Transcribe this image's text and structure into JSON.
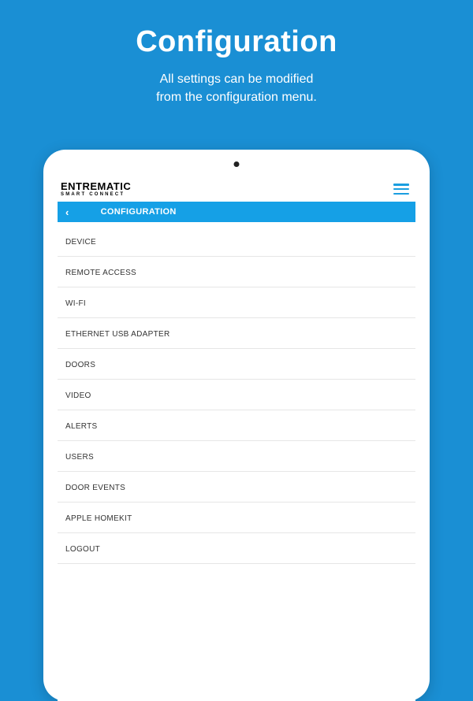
{
  "hero": {
    "title": "Configuration",
    "subtitle_line1": "All settings can be modified",
    "subtitle_line2": "from the configuration menu."
  },
  "app": {
    "brand_main": "ENTREMATIC",
    "brand_sub": "SMART CONNECT",
    "page_title": "CONFIGURATION",
    "back_glyph": "‹"
  },
  "menu": {
    "items": [
      {
        "label": "DEVICE"
      },
      {
        "label": "REMOTE ACCESS"
      },
      {
        "label": "WI-FI"
      },
      {
        "label": "ETHERNET USB ADAPTER"
      },
      {
        "label": "DOORS"
      },
      {
        "label": "VIDEO"
      },
      {
        "label": "ALERTS"
      },
      {
        "label": "USERS"
      },
      {
        "label": "DOOR EVENTS"
      },
      {
        "label": "APPLE HOMEKIT"
      },
      {
        "label": "LOGOUT"
      }
    ]
  },
  "colors": {
    "bg": "#1a8fd4",
    "accent": "#15a0e6"
  }
}
